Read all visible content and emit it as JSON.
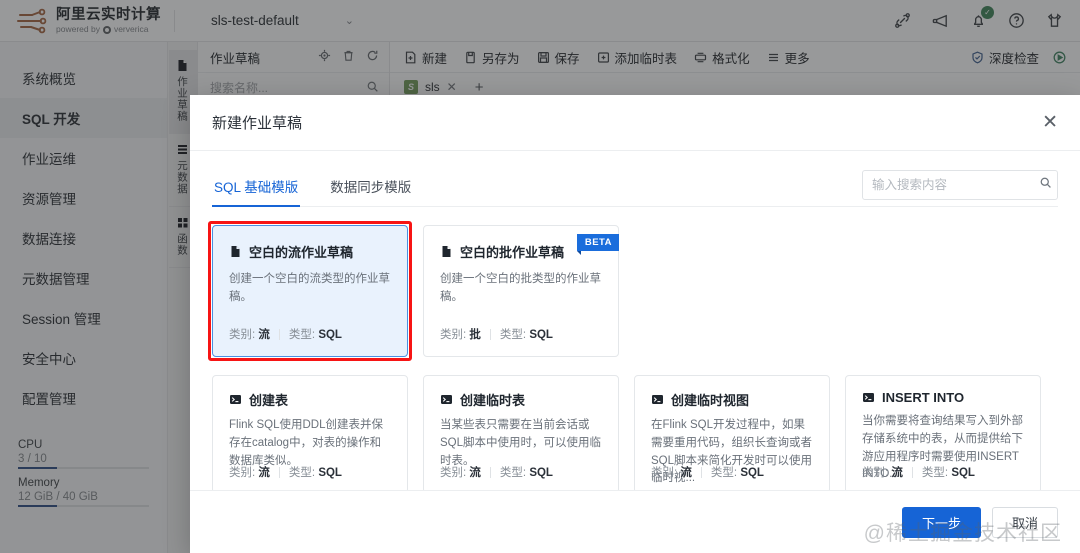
{
  "topbar": {
    "logo_title": "阿里云实时计算",
    "logo_sub_pre": "powered by",
    "logo_sub_brand": "ververica",
    "project": "sls-test-default",
    "icons": [
      {
        "name": "link-icon"
      },
      {
        "name": "megaphone-icon"
      },
      {
        "name": "bell-icon",
        "badge": "✓"
      },
      {
        "name": "help-icon"
      },
      {
        "name": "skin-icon"
      }
    ]
  },
  "sidebar": {
    "items": [
      {
        "label": "系统概览",
        "active": false
      },
      {
        "label": "SQL 开发",
        "active": true
      },
      {
        "label": "作业运维",
        "active": false
      },
      {
        "label": "资源管理",
        "active": false
      },
      {
        "label": "数据连接",
        "active": false
      },
      {
        "label": "元数据管理",
        "active": false
      },
      {
        "label": "Session 管理",
        "active": false
      },
      {
        "label": "安全中心",
        "active": false
      },
      {
        "label": "配置管理",
        "active": false
      }
    ],
    "resources": [
      {
        "label": "CPU",
        "value": "3 / 10",
        "percent": 30
      },
      {
        "label": "Memory",
        "value": "12 GiB / 40 GiB",
        "percent": 30
      }
    ]
  },
  "rail": {
    "items": [
      {
        "label": "作业草稿",
        "icon": "file-icon",
        "active": true
      },
      {
        "label": "元数据",
        "icon": "list-icon",
        "active": false
      },
      {
        "label": "函数",
        "icon": "grid-icon",
        "active": false
      }
    ]
  },
  "drafts": {
    "title": "作业草稿",
    "actions": [
      "locate-icon",
      "trash-icon",
      "refresh-icon"
    ],
    "search_placeholder": "搜索名称..."
  },
  "editor": {
    "toolbar": [
      {
        "label": "新建",
        "icon": "new-file-icon"
      },
      {
        "label": "另存为",
        "icon": "save-as-icon"
      },
      {
        "label": "保存",
        "icon": "save-icon"
      },
      {
        "label": "添加临时表",
        "icon": "add-table-icon"
      },
      {
        "label": "格式化",
        "icon": "format-icon"
      },
      {
        "label": "更多",
        "icon": "more-icon"
      }
    ],
    "deep_check": "深度检查",
    "tab": {
      "badge": "S",
      "label": "sls",
      "close": "✕",
      "add": "+"
    }
  },
  "modal": {
    "title": "新建作业草稿",
    "close": "✕",
    "tabs": [
      {
        "label": "SQL 基础模版",
        "active": true
      },
      {
        "label": "数据同步模版",
        "active": false
      }
    ],
    "search": {
      "placeholder": "输入搜索内容",
      "value": ""
    },
    "meta_labels": {
      "category": "类别:",
      "type": "类型:"
    },
    "cards_row1": [
      {
        "title": "空白的流作业草稿",
        "icon": "file-icon",
        "desc": "创建一个空白的流类型的作业草稿。",
        "category": "流",
        "type": "SQL",
        "selected": true,
        "highlighted": true,
        "beta": null
      },
      {
        "title": "空白的批作业草稿",
        "icon": "file-icon",
        "desc": "创建一个空白的批类型的作业草稿。",
        "category": "批",
        "type": "SQL",
        "selected": false,
        "highlighted": false,
        "beta": "BETA"
      }
    ],
    "cards_row2": [
      {
        "title": "创建表",
        "icon": "terminal-icon",
        "desc": "Flink SQL使用DDL创建表并保存在catalog中，对表的操作和数据库类似。",
        "category": "流",
        "type": "SQL"
      },
      {
        "title": "创建临时表",
        "icon": "terminal-icon",
        "desc": "当某些表只需要在当前会话或SQL脚本中使用时，可以使用临时表。",
        "category": "流",
        "type": "SQL"
      },
      {
        "title": "创建临时视图",
        "icon": "terminal-icon",
        "desc": "在Flink SQL开发过程中，如果需要重用代码，组织长查询或者SQL脚本来简化开发时可以使用临时视...",
        "category": "流",
        "type": "SQL"
      },
      {
        "title": "INSERT INTO",
        "icon": "terminal-icon",
        "desc": "当你需要将查询结果写入到外部存储系统中的表，从而提供给下游应用程序时需要使用INSERT INTO...",
        "category": "流",
        "type": "SQL"
      }
    ],
    "footer": {
      "next": "下一步",
      "cancel": "取消"
    }
  },
  "watermark": "@稀土掘金技术社区",
  "colors": {
    "accent": "#1664d6",
    "highlight": "#f71414",
    "selected_bg": "#e9f2fd",
    "badge_green": "#15a34a"
  }
}
